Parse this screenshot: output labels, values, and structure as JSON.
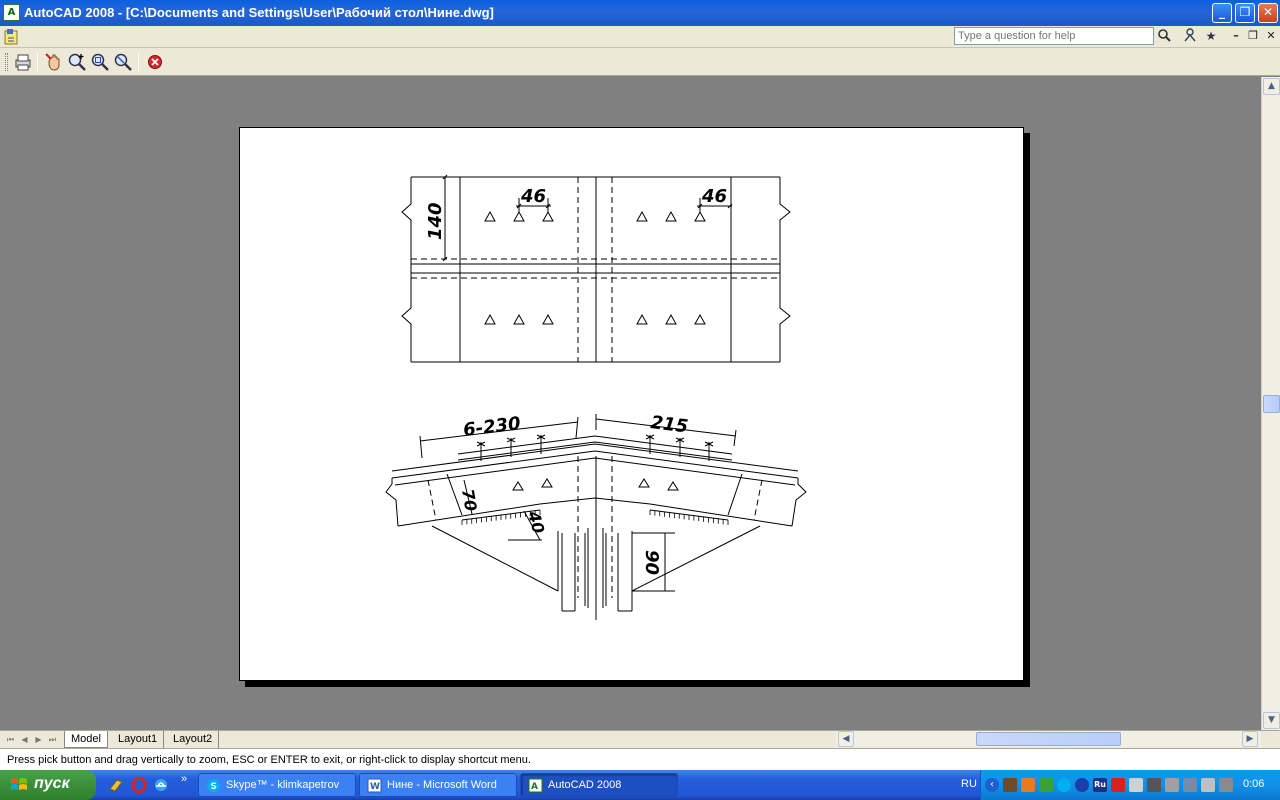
{
  "window": {
    "app_icon": "autocad-app-icon",
    "title": "AutoCAD 2008 - [C:\\Documents and Settings\\User\\Рабочий стол\\Нине.dwg]",
    "buttons": {
      "minimize": "_",
      "restore": "❐",
      "close": "✕"
    }
  },
  "menubar": {
    "doc_icon": "drawing-document-icon",
    "help_placeholder": "Type a question for help",
    "help_icons": [
      "search-icon",
      "communication-center-icon",
      "favorites-star-icon"
    ],
    "mdi_buttons": {
      "minimize": "–",
      "restore": "❐",
      "close": "✕"
    }
  },
  "toolbar": {
    "buttons": [
      {
        "name": "print-icon",
        "label": "Print"
      },
      {
        "name": "pan-icon",
        "label": "Pan"
      },
      {
        "name": "zoom-realtime-icon",
        "label": "Zoom Realtime"
      },
      {
        "name": "zoom-window-icon",
        "label": "Zoom Window"
      },
      {
        "name": "zoom-original-icon",
        "label": "Zoom Original"
      },
      {
        "name": "close-preview-icon",
        "label": "Close Preview Window"
      }
    ]
  },
  "drawing": {
    "top_view": {
      "dim_top_left": "46",
      "dim_top_right": "46",
      "dim_left": "140"
    },
    "bottom_view": {
      "dim_left": "6-230",
      "dim_right": "215",
      "dim_web": "70",
      "dim_gap": "40",
      "dim_gusset": "90"
    }
  },
  "tabs": {
    "nav": [
      "⏮",
      "◀",
      "▶",
      "⏭"
    ],
    "items": [
      {
        "label": "Model",
        "active": true
      },
      {
        "label": "Layout1",
        "active": false
      },
      {
        "label": "Layout2",
        "active": false
      }
    ]
  },
  "scrollbars": {
    "up": "▲",
    "down": "▼",
    "left": "◀",
    "right": "▶"
  },
  "command_line": "Press pick button and drag vertically to zoom, ESC or ENTER to exit, or right-click to display shortcut menu.",
  "taskbar": {
    "start_label": "пуск",
    "quick_launch": [
      "show-desktop-icon",
      "opera-icon",
      "internet-explorer-icon"
    ],
    "quick_launch_more": "»",
    "tasks": [
      {
        "label": "Skype™ - klimkapetrov",
        "icon": "skype-icon",
        "active": false
      },
      {
        "label": "Нине - Microsoft Word",
        "icon": "word-icon",
        "active": false
      },
      {
        "label": "AutoCAD 2008",
        "icon": "autocad-icon",
        "active": true
      }
    ],
    "tray": {
      "language": "RU",
      "icons": [
        "tray-back-icon",
        "tray-network-icon",
        "tray-firewall-icon",
        "tray-shield-icon",
        "tray-skype-icon",
        "tray-bluetooth-icon",
        "tray-ru-keyboard-icon",
        "tray-antivirus-icon",
        "tray-app-icon",
        "tray-tools-icon",
        "tray-connection-icon",
        "tray-network2-icon",
        "tray-volume-icon",
        "tray-display-icon",
        "tray-update-icon"
      ],
      "clock": "0:06"
    }
  }
}
